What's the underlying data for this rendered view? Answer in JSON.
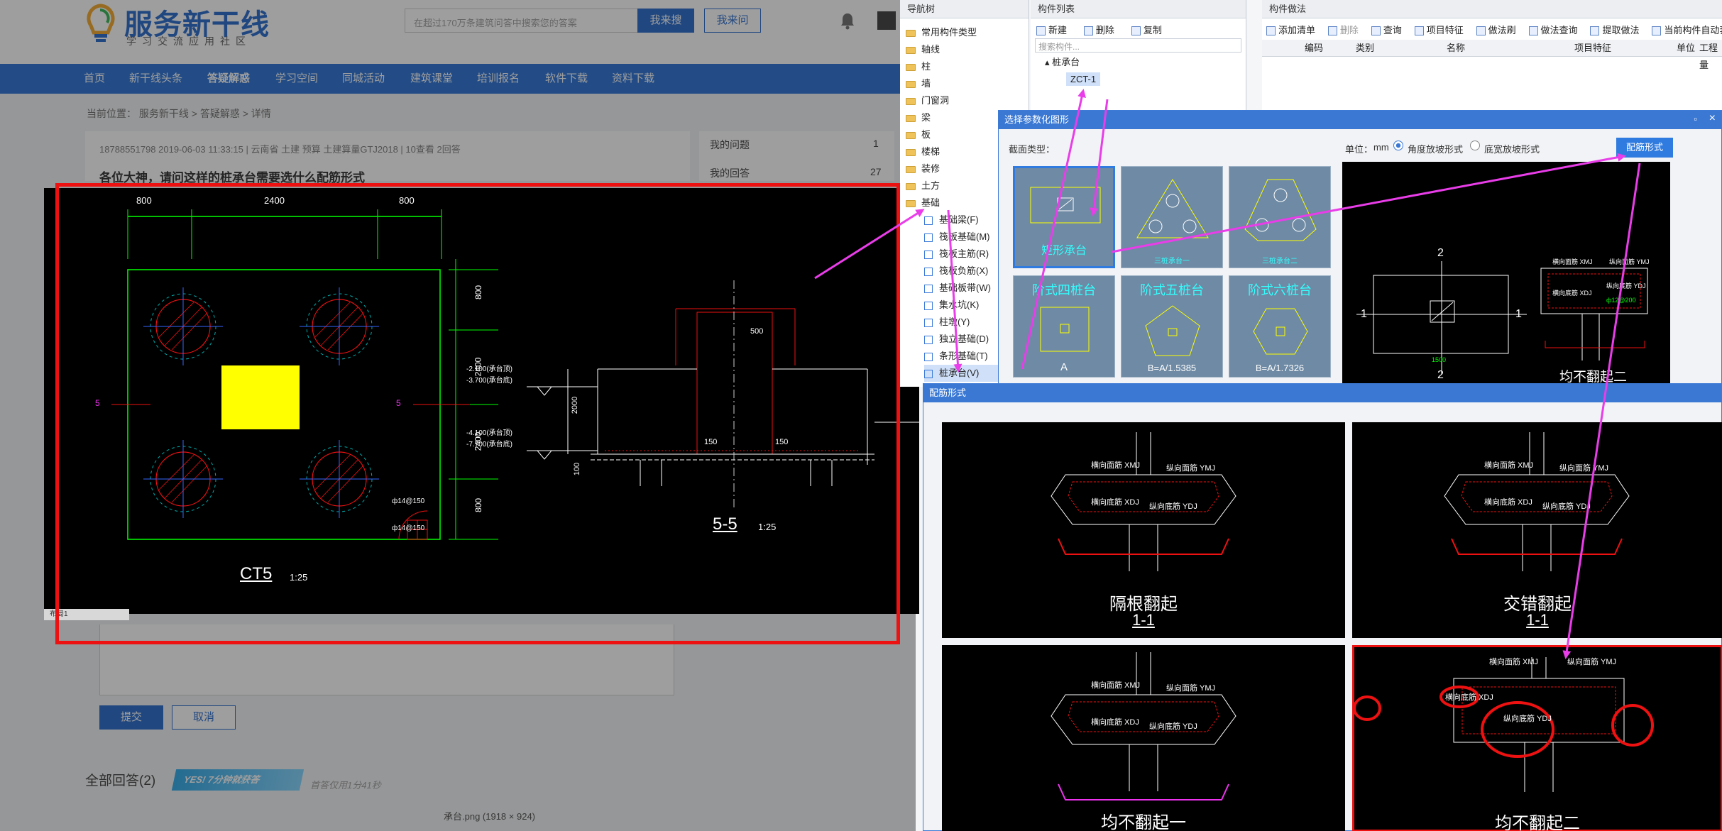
{
  "site": {
    "logo": "服务新干线",
    "logo_sub": "学习交流应用社区",
    "search_placeholder": "在超过170万条建筑问答中搜索您的答案",
    "search_button": "我来搜",
    "ask_button": "我来问",
    "nav": [
      "首页",
      "新干线头条",
      "答疑解惑",
      "学习空间",
      "同城活动",
      "建筑课堂",
      "培训报名",
      "软件下载",
      "资料下载"
    ],
    "breadcrumb": "当前位置： 服务新干线 > 答疑解惑 > 详情",
    "question_meta": "18788551798    2019-06-03 11:33:15    |    云南省   土建 预算 土建算量GTJ2018    |    10查看   2回答",
    "question_title": "各位大神，请问这样的桩承台需要选什么配筋形式",
    "sidebar": [
      {
        "label": "我的问题",
        "count": "1"
      },
      {
        "label": "我的回答",
        "count": "27"
      }
    ],
    "submit_button": "提交",
    "cancel_button": "取消",
    "all_answers": "全部回答(2)",
    "yes_badge": "YES! 7分钟就获答",
    "answer_time": "首答仅用1分41秒",
    "image_caption": "承台.png (1918 × 924)"
  },
  "cad": {
    "dims_top": [
      "800",
      "2400",
      "800"
    ],
    "dims_right": [
      "800",
      "2400",
      "2400",
      "800"
    ],
    "levels": [
      "-2.100(承台顶)",
      "-3.700(承台底)",
      "-4.100(承台顶)",
      "-7.700(承台底)"
    ],
    "section_label": "5-5",
    "section_scale": "1:25",
    "plan_label": "CT5",
    "plan_scale": "1:25",
    "mark_500": "500",
    "mark_150a": "150",
    "mark_150b": "150",
    "mark_2000": "2000",
    "mark_100": "100",
    "side_marks": [
      "5",
      "5"
    ],
    "rebar_note_1": "ф14@150",
    "rebar_note_2": "ф14@150",
    "tab": "布局1"
  },
  "app": {
    "nav_tree_title": "导航树",
    "nav_tree": [
      "常用构件类型",
      "轴线",
      "柱",
      "墙",
      "门窗洞",
      "梁",
      "板",
      "楼梯",
      "装修",
      "土方",
      "基础"
    ],
    "foundation_children": [
      "基础梁(F)",
      "筏板基础(M)",
      "筏板主筋(R)",
      "筏板负筋(X)",
      "基础板带(W)",
      "集水坑(K)",
      "柱墩(Y)",
      "独立基础(D)",
      "条形基础(T)",
      "桩承台(V)"
    ],
    "component_list_title": "构件列表",
    "component_toolbar": [
      "新建",
      "删除",
      "复制"
    ],
    "component_search": "搜索构件...",
    "component_tree_root": "桩承台",
    "component_tree_child": "ZCT-1",
    "method_title": "构件做法",
    "method_toolbar": [
      "添加清单",
      "删除",
      "查询",
      "项目特征",
      "做法刷",
      "做法查询",
      "提取做法",
      "当前构件自动套做法"
    ],
    "method_columns": [
      "编码",
      "类别",
      "名称",
      "项目特征",
      "单位",
      "工程量"
    ]
  },
  "dialog1": {
    "title": "选择参数化图形",
    "section_type_label": "截面类型：",
    "unit_label": "单位：",
    "unit_value": "mm",
    "radio_angle": "角度放坡形式",
    "radio_width": "底宽放坡形式",
    "rebar_button": "配筋形式",
    "shapes": [
      {
        "label": "矩形承台",
        "sub": ""
      },
      {
        "label": "",
        "sub": "三桩承台一"
      },
      {
        "label": "",
        "sub": "三桩承台二"
      },
      {
        "label": "阶式四桩台",
        "sub": "A"
      },
      {
        "label": "阶式五桩台",
        "sub": "B=A/1.5385"
      },
      {
        "label": "阶式六桩台",
        "sub": "B=A/1.7326"
      }
    ],
    "preview_dim_top": "2",
    "preview_dim_bottom": "2",
    "preview_dim_left": "1",
    "preview_dim_right": "1",
    "preview_dim_1500": "1500",
    "preview_caption": "均不翻起二",
    "preview_labels": [
      "横向面筋 XMJ",
      "纵向面筋 YMJ",
      "横向底筋 XDJ",
      "纵向底筋 YDJ",
      "ф12@200"
    ]
  },
  "dialog2": {
    "title": "配筋形式",
    "tiles": [
      {
        "title": "隔根翻起",
        "sub": "1-1"
      },
      {
        "title": "交错翻起",
        "sub": "1-1"
      },
      {
        "title": "均不翻起一",
        "sub": ""
      },
      {
        "title": "均不翻起二",
        "sub": ""
      }
    ],
    "labels": {
      "xmj": "横向面筋 XMJ",
      "ymj": "纵向面筋 YMJ",
      "xdj": "横向底筋 XDJ",
      "ydj": "纵向底筋 YDJ"
    }
  },
  "colors": {
    "brand_blue": "#1f6ad3",
    "highlight_red": "#e11111",
    "arrow_magenta": "#e83de8",
    "cad_yellow": "#ffff00",
    "dialog_title": "#3a78d4"
  }
}
